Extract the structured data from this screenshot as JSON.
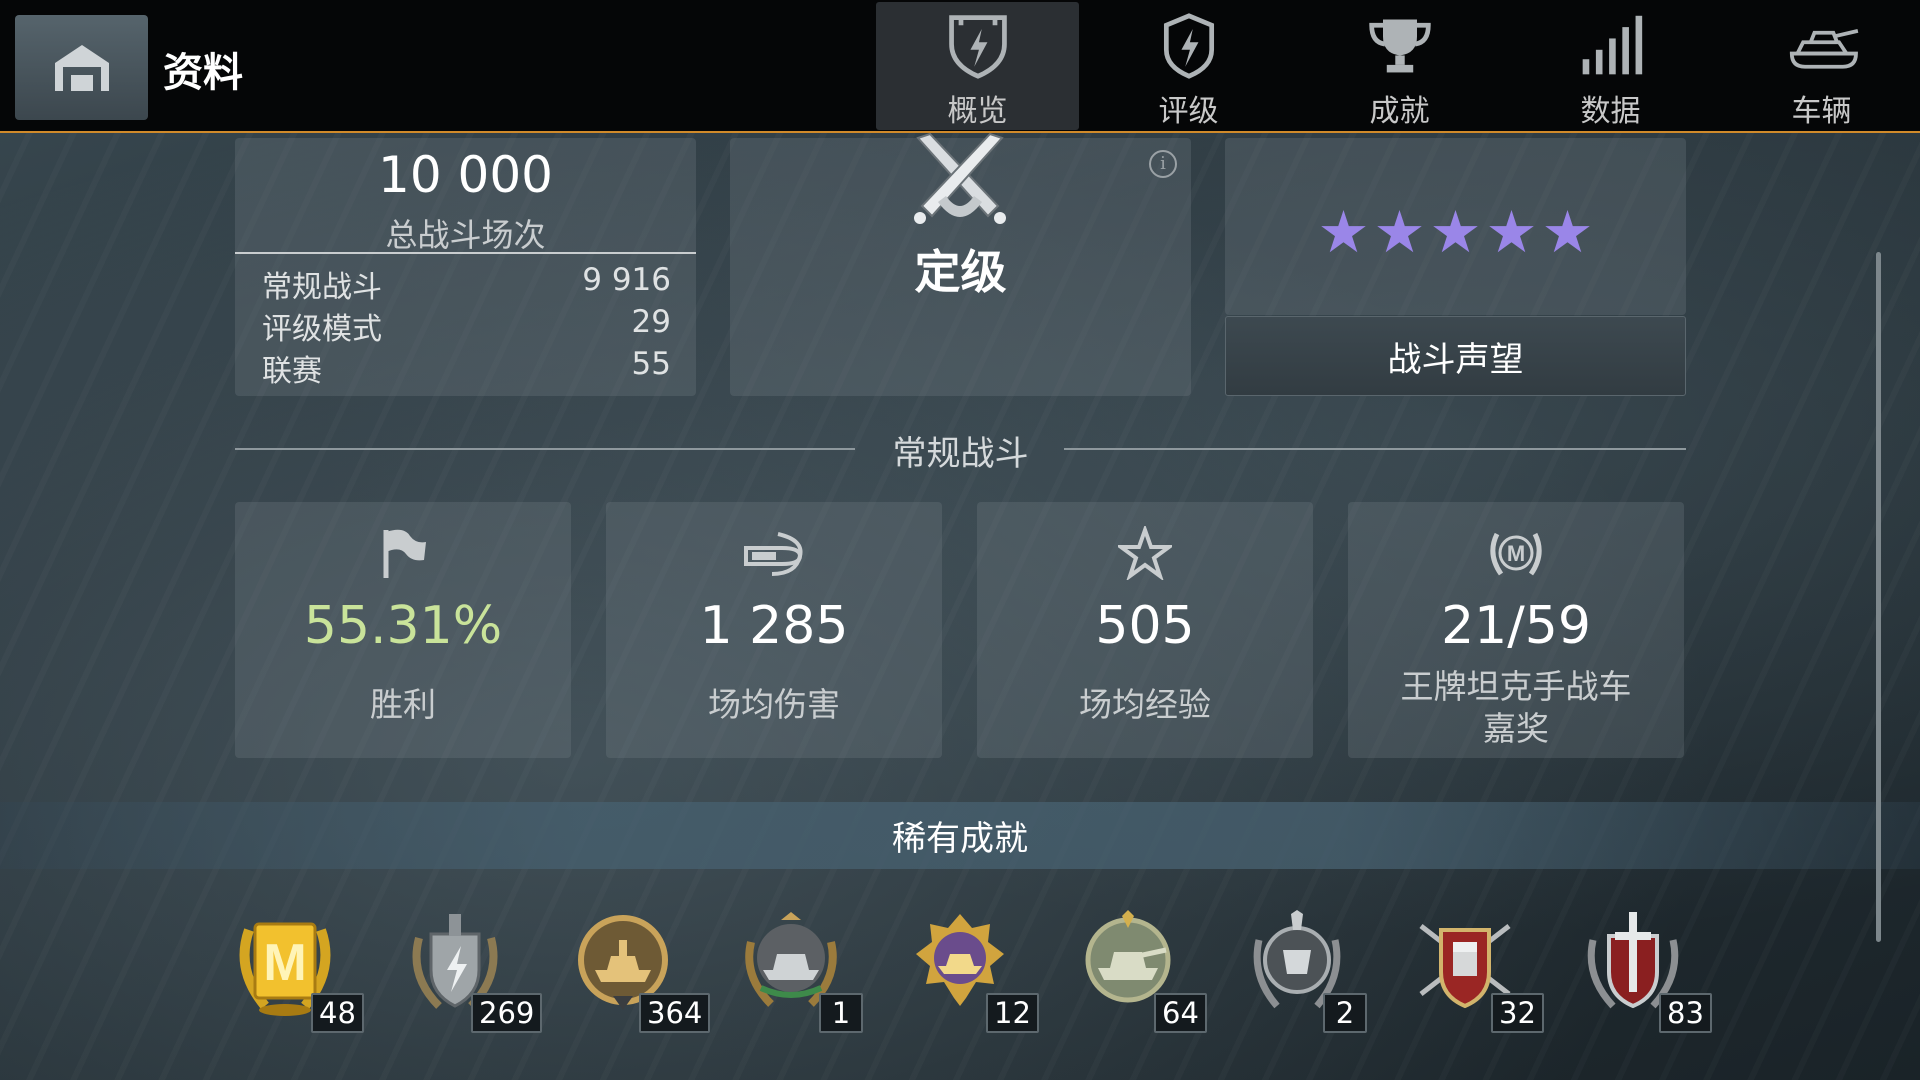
{
  "header": {
    "title": "资料",
    "tabs": [
      {
        "label": "概览",
        "icon": "shield-icon",
        "active": true
      },
      {
        "label": "评级",
        "icon": "ranked-badge-icon",
        "active": false
      },
      {
        "label": "成就",
        "icon": "trophy-icon",
        "active": false
      },
      {
        "label": "数据",
        "icon": "bar-signal-icon",
        "active": false
      },
      {
        "label": "车辆",
        "icon": "tank-icon",
        "active": false
      }
    ]
  },
  "total": {
    "value": "10 000",
    "label": "总战斗场次",
    "rows": [
      {
        "label": "常规战斗",
        "value": "9 916"
      },
      {
        "label": "评级模式",
        "value": "29"
      },
      {
        "label": "联赛",
        "value": "55"
      }
    ]
  },
  "rank": {
    "label": "定级",
    "icon": "crossed-swords-icon"
  },
  "reputation": {
    "stars": 5,
    "button_label": "战斗声望",
    "star_color": "#9a86e8"
  },
  "regular_section": {
    "title": "常规战斗"
  },
  "stats": [
    {
      "value": "55.31%",
      "label": "胜利",
      "icon": "flag-icon",
      "value_color": "#c9e39a"
    },
    {
      "value": "1 285",
      "label": "场均伤害",
      "icon": "shell-icon",
      "value_color": "#ffffff"
    },
    {
      "value": "505",
      "label": "场均经验",
      "icon": "star-icon",
      "value_color": "#ffffff"
    },
    {
      "value": "21/59",
      "label": "王牌坦克手战车",
      "label2": "嘉奖",
      "icon": "mastery-badge-icon",
      "value_color": "#ffffff"
    }
  ],
  "rare": {
    "title": "稀有成就",
    "items": [
      {
        "icon": "ace-tanker-medal-icon",
        "count": "48"
      },
      {
        "icon": "lightning-shield-medal-icon",
        "count": "269"
      },
      {
        "icon": "tank-wreath-medal-icon",
        "count": "364"
      },
      {
        "icon": "heavy-tank-medal-icon",
        "count": "1"
      },
      {
        "icon": "gold-tank-medal-icon",
        "count": "12"
      },
      {
        "icon": "silver-tank-medal-icon",
        "count": "64"
      },
      {
        "icon": "emblem-medal-icon",
        "count": "2"
      },
      {
        "icon": "fist-arrows-medal-icon",
        "count": "32"
      },
      {
        "icon": "sword-shield-medal-icon",
        "count": "83"
      }
    ]
  }
}
